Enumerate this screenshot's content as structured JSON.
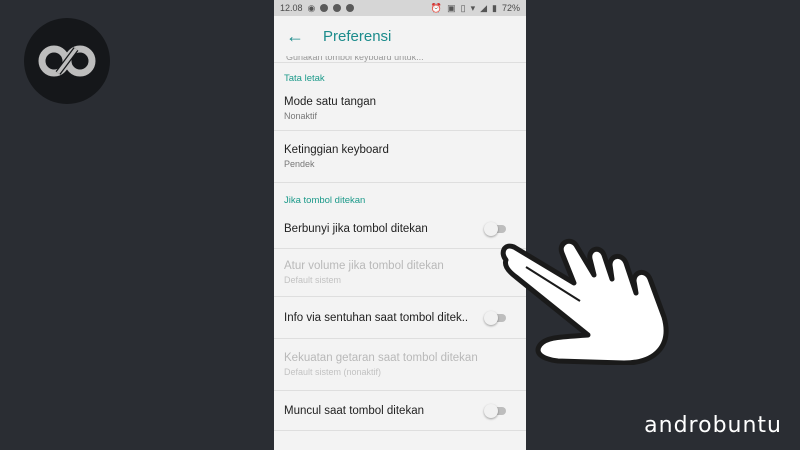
{
  "statusbar": {
    "time": "12.08",
    "battery": "72%"
  },
  "appbar": {
    "title": "Preferensi"
  },
  "cut_text": "Gunakan tombol keyboard untuk...",
  "sections": {
    "layout_header": "Tata letak",
    "keypress_header": "Jika tombol ditekan"
  },
  "prefs": {
    "one_hand": {
      "title": "Mode satu tangan",
      "summary": "Nonaktif"
    },
    "height": {
      "title": "Ketinggian keyboard",
      "summary": "Pendek"
    },
    "sound": {
      "title": "Berbunyi jika tombol ditekan",
      "checked": false
    },
    "volume": {
      "title": "Atur volume jika tombol ditekan",
      "summary": "Default sistem"
    },
    "haptic": {
      "title": "Info via sentuhan saat tombol ditek..",
      "checked": false
    },
    "vibration": {
      "title": "Kekuatan getaran saat tombol ditekan",
      "summary": "Default sistem (nonaktif)"
    },
    "popup": {
      "title": "Muncul saat tombol ditekan",
      "checked": false
    }
  },
  "watermark": "androbuntu",
  "colors": {
    "accent": "#1c8c8c",
    "background": "#2a2d33"
  }
}
